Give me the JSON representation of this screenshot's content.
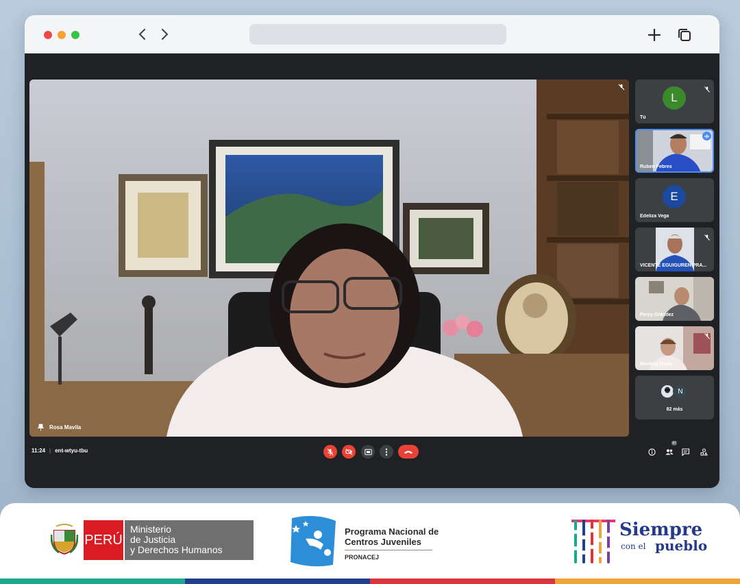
{
  "browser": {
    "traffic_lights": [
      "#ed4b45",
      "#f5a230",
      "#39c24a"
    ],
    "back_icon": "chevron-left-icon",
    "forward_icon": "chevron-right-icon",
    "new_tab_icon": "plus-icon",
    "tabs_icon": "copy-icon"
  },
  "meet": {
    "main_speaker": "Rosa Mavila",
    "time": "11:24",
    "meeting_code": "ent-wtyu-tbu",
    "participants": [
      {
        "name": "Tú",
        "avatar_letter": "L",
        "avatar_color": "#3a8a2c",
        "muted": true,
        "video": false
      },
      {
        "name": "Ruben Febres",
        "video": true,
        "speaking": true
      },
      {
        "name": "Edeliza Vega",
        "avatar_letter": "E",
        "avatar_color": "#1a4aa0",
        "muted": false,
        "video": false
      },
      {
        "name": "VICENTE EGUIGUREN PRA...",
        "video": true,
        "muted": true
      },
      {
        "name": "Percy Grández",
        "video": true
      },
      {
        "name": "Marleny Rojas",
        "video": true,
        "muted": true
      }
    ],
    "more": {
      "label": "82 más",
      "avatar_letter": "N"
    },
    "people_count": "87",
    "accent_red": "#ea4335"
  },
  "footer": {
    "peru": "PERÚ",
    "ministry": [
      "Ministerio",
      "de Justicia",
      "y Derechos Humanos"
    ],
    "program": [
      "Programa Nacional de",
      "Centros Juveniles"
    ],
    "program_short": "PRONACEJ",
    "slogan_1": "Siempre",
    "slogan_2": "con el",
    "slogan_3": "pueblo",
    "stripe_colors": [
      "#1aa98f",
      "#213f8c",
      "#d9353a",
      "#f0a33a"
    ]
  }
}
